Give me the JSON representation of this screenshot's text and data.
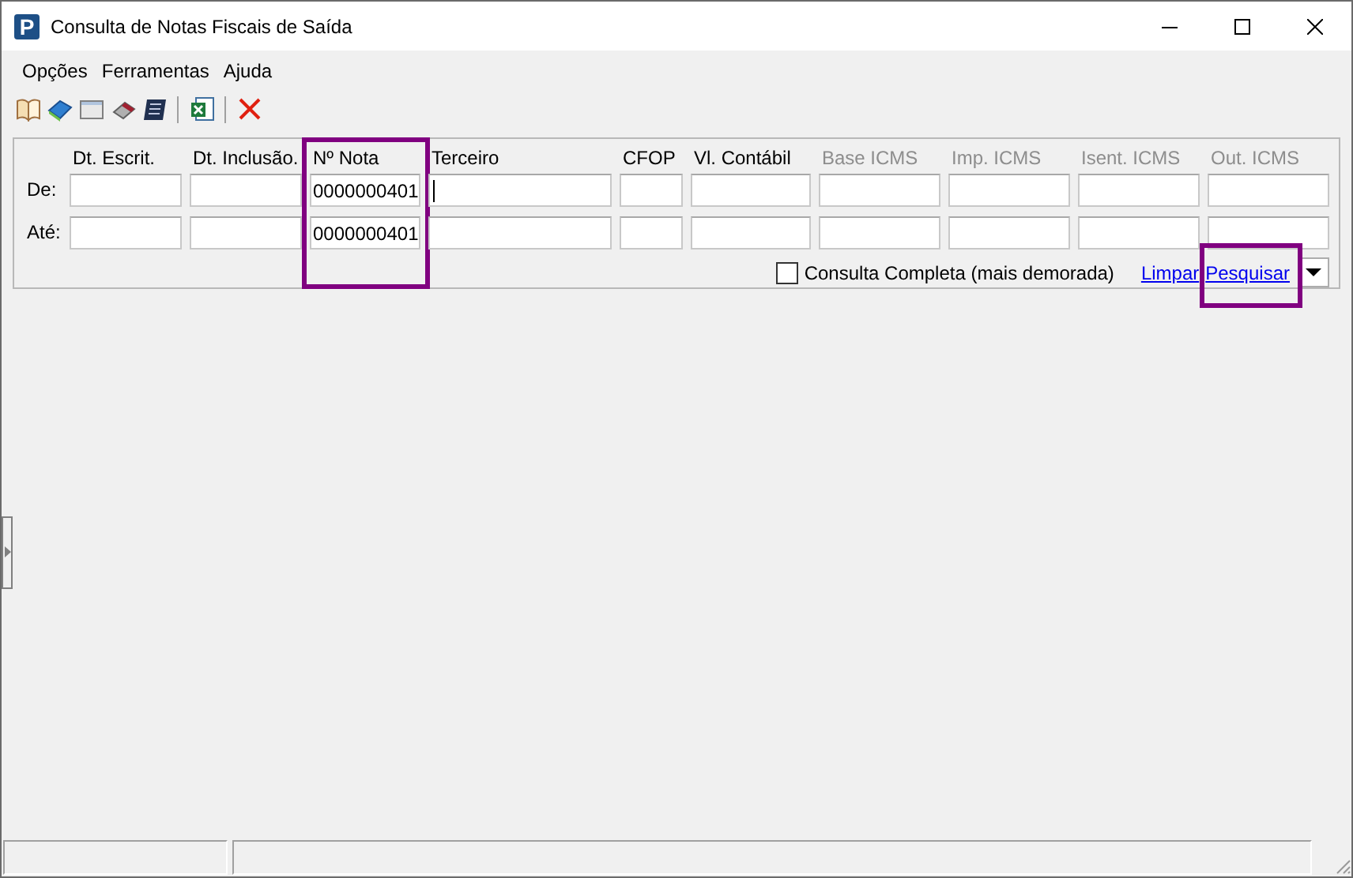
{
  "window": {
    "logo_letter": "P",
    "title": "Consulta de Notas Fiscais de Saída"
  },
  "menu": [
    {
      "label": "Opções"
    },
    {
      "label": "Ferramentas"
    },
    {
      "label": "Ajuda"
    }
  ],
  "filter": {
    "row_labels": [
      "De:",
      "Até:"
    ],
    "columns": [
      {
        "label": "Dt. Escrit.",
        "disabled": false,
        "highlighted": false
      },
      {
        "label": "Dt. Inclusão.",
        "disabled": false,
        "highlighted": false
      },
      {
        "label": "Nº Nota",
        "disabled": false,
        "highlighted": true,
        "from": "0000000401",
        "to": "0000000401"
      },
      {
        "label": "Terceiro",
        "disabled": false,
        "highlighted": false,
        "from_focused": true
      },
      {
        "label": "CFOP",
        "disabled": false,
        "highlighted": false
      },
      {
        "label": "Vl. Contábil",
        "disabled": false,
        "highlighted": false
      },
      {
        "label": "Base ICMS",
        "disabled": true,
        "highlighted": false
      },
      {
        "label": "Imp. ICMS",
        "disabled": true,
        "highlighted": false
      },
      {
        "label": "Isent. ICMS",
        "disabled": true,
        "highlighted": false
      },
      {
        "label": "Out. ICMS",
        "disabled": true,
        "highlighted": false
      }
    ],
    "full_query": {
      "label": "Consulta Completa (mais demorada)",
      "checked": false
    },
    "links": [
      {
        "label": "Limpar",
        "highlighted": false
      },
      {
        "label": "Pesquisar",
        "highlighted": true
      }
    ]
  }
}
